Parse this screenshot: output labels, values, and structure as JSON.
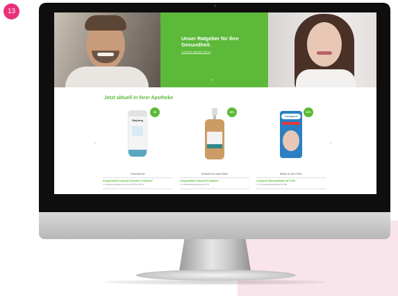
{
  "step_number": "13",
  "hero": {
    "title": "Unser Ratgeber für Ihre Gesundheit.",
    "link": "zu weiteren aktuellen Themen"
  },
  "section": {
    "title": "Jetzt aktuell in Ihrer Apotheke"
  },
  "products": [
    {
      "badge": "5€",
      "category": "Sonnenschutz",
      "title": "Ausgewählte Daylong Sensitive Produkte*",
      "subtitle": "z. B. Daylong Sensitive Gel-Creme SPF 50+ 100 ml",
      "brand": "Daylong"
    },
    {
      "badge": "20% Rabatt",
      "category": "Schweiß und nasse Beine",
      "title": "Ausgewählte Hirudoid Produkte*",
      "subtitle": "z. B. Hirudoid Gelat as Spray 100 ml"
    },
    {
      "badge": "20% Rabatt",
      "category": "Blasen an den Füßen",
      "title": "Compeed Blasenpflaster M 5 Stk.",
      "subtitle": "z. B. Compeed Blasenpflaster M 5 Stk.",
      "brand": "Compeed"
    }
  ],
  "colors": {
    "brand_green": "#5cb939",
    "step_pink": "#e8307a"
  },
  "icons": {
    "left_arrow": "chevron-left-icon",
    "right_arrow": "chevron-right-icon",
    "hero_chevron": "chevron-down-icon"
  }
}
